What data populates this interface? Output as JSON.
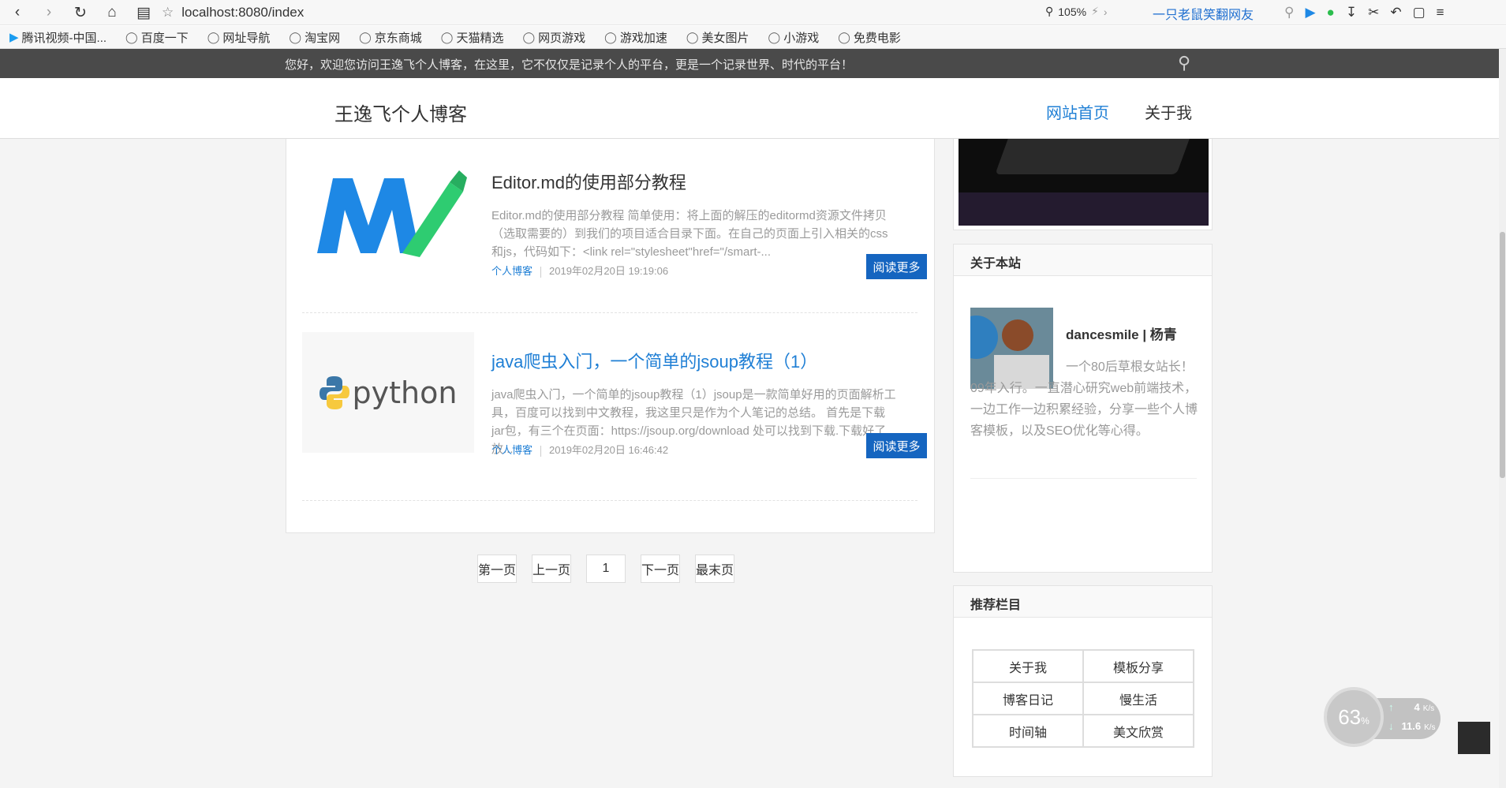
{
  "browser": {
    "url": "localhost:8080/index",
    "zoom": "105%",
    "user_link": "一只老鼠笑翻网友",
    "bookmarks": [
      "腾讯视频-中国...",
      "百度一下",
      "网址导航",
      "淘宝网",
      "京东商城",
      "天猫精选",
      "网页游戏",
      "游戏加速",
      "美女图片",
      "小游戏",
      "免费电影"
    ]
  },
  "welcome": "您好，欢迎您访问王逸飞个人博客，在这里，它不仅仅是记录个人的平台，更是一个记录世界、时代的平台！",
  "header": {
    "logo": "王逸飞个人博客",
    "nav": [
      "网站首页",
      "关于我"
    ]
  },
  "articles": [
    {
      "title": "Editor.md的使用部分教程",
      "desc": "Editor.md的使用部分教程 简单使用：将上面的解压的editormd资源文件拷贝（选取需要的）到我们的项目适合目录下面。在自己的页面上引入相关的css和js，代码如下：<link rel=\"stylesheet\"href=\"/smart-...",
      "category": "个人博客",
      "date": "2019年02月20日 19:19:06",
      "button": "阅读更多"
    },
    {
      "title": "java爬虫入门，一个简单的jsoup教程（1）",
      "desc": "java爬虫入门，一个简单的jsoup教程（1）jsoup是一款简单好用的页面解析工具，百度可以找到中文教程，我这里只是作为个人笔记的总结。 首先是下载jar包，有三个在页面：https://jsoup.org/download 处可以找到下载.下载好了放...",
      "category": "个人博客",
      "date": "2019年02月20日 16:46:42",
      "button": "阅读更多",
      "thumb_text": "python"
    }
  ],
  "pager": [
    "第一页",
    "上一页",
    "1",
    "下一页",
    "最末页"
  ],
  "about": {
    "heading": "关于本站",
    "name": "dancesmile | 杨青",
    "intro": "一个80后草根女站长！09年入行。一直潜心研究web前端技术，一边工作一边积累经验，分享一些个人博客模板，以及SEO优化等心得。"
  },
  "recommend": {
    "heading": "推荐栏目",
    "items": [
      "关于我",
      "模板分享",
      "博客日记",
      "慢生活",
      "时间轴",
      "美文欣赏"
    ]
  },
  "widget": {
    "percent": "63",
    "percent_unit": "%",
    "up": "4",
    "up_unit": "K/s",
    "down": "11.6",
    "down_unit": "K/s"
  },
  "colors": {
    "accent": "#1f7fd5",
    "button": "#1565c0",
    "welcome_bg": "#4a4a4a"
  }
}
